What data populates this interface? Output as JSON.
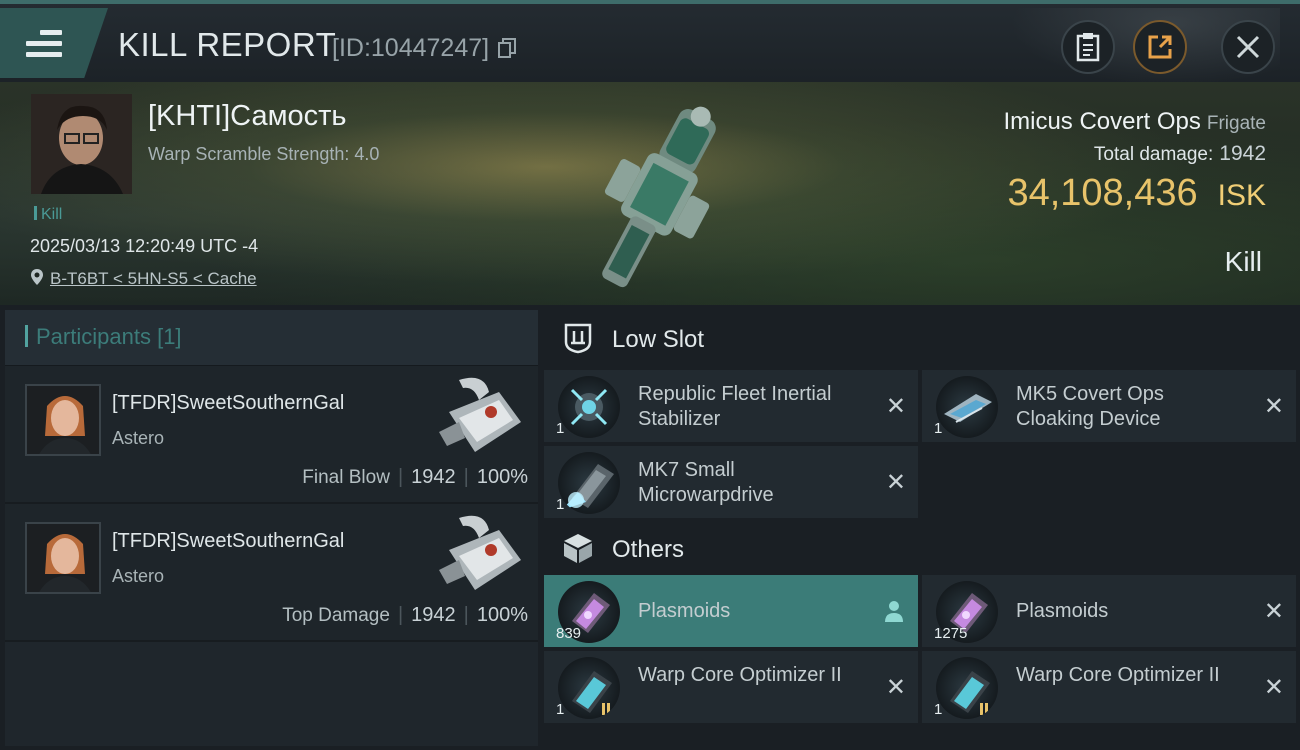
{
  "header": {
    "title": "KILL REPORT",
    "report_id": "[ID:10447247]"
  },
  "victim": {
    "pilot": "[KHTI]Самость",
    "scramble": "Warp Scramble Strength: 4.0",
    "kill_tag": "Kill",
    "datetime": "2025/03/13 12:20:49 UTC -4",
    "location": "B-T6BT < 5HN-S5 < Cache",
    "ship_name": "Imicus Covert Ops",
    "ship_class": "Frigate",
    "total_damage_label": "Total damage:",
    "total_damage": "1942",
    "isk_value": "34,108,436",
    "isk_unit": "ISK",
    "result": "Kill"
  },
  "participants": {
    "label": "Participants",
    "count": "[1]",
    "rows": [
      {
        "name": "[TFDR]SweetSouthernGal",
        "ship": "Astero",
        "stat_label": "Final Blow",
        "damage": "1942",
        "percent": "100%"
      },
      {
        "name": "[TFDR]SweetSouthernGal",
        "ship": "Astero",
        "stat_label": "Top Damage",
        "damage": "1942",
        "percent": "100%"
      }
    ]
  },
  "low_slot": {
    "label": "Low Slot",
    "items": [
      {
        "name": "Republic Fleet Inertial Stabilizer",
        "qty": "1",
        "status": "destroyed"
      },
      {
        "name": "MK5 Covert Ops Cloaking Device",
        "qty": "1",
        "status": "destroyed"
      },
      {
        "name": "MK7 Small Microwarpdrive",
        "qty": "1",
        "status": "destroyed"
      }
    ]
  },
  "others": {
    "label": "Others",
    "items": [
      {
        "name": "Plasmoids",
        "qty": "839",
        "status": "dropped"
      },
      {
        "name": "Plasmoids",
        "qty": "1275",
        "status": "destroyed"
      },
      {
        "name": "Warp Core Optimizer II",
        "qty": "1",
        "status": "destroyed"
      },
      {
        "name": "Warp Core Optimizer II",
        "qty": "1",
        "status": "destroyed"
      }
    ]
  },
  "colors": {
    "accent_teal": "#3b7c78",
    "isk_gold": "#e8c36a"
  }
}
